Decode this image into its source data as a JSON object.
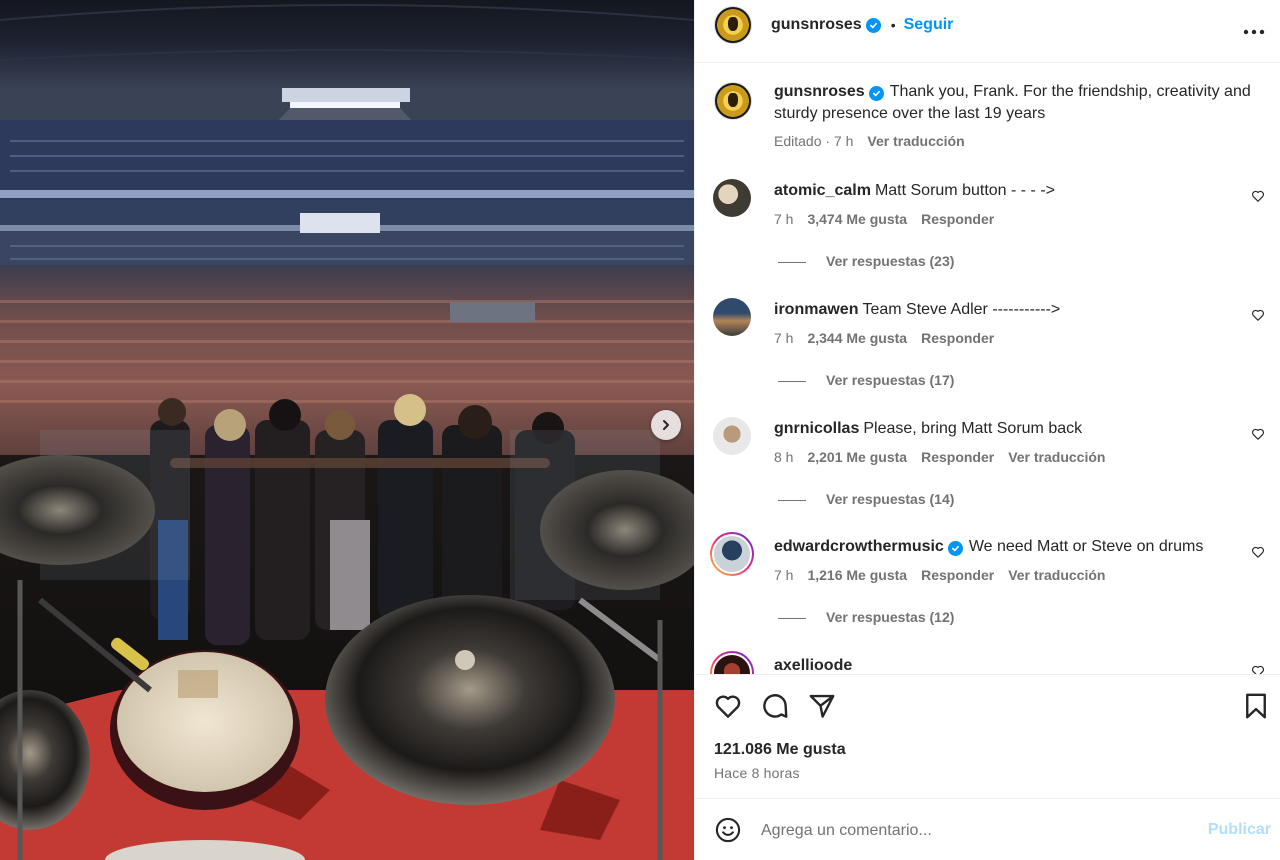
{
  "post": {
    "author": "gunsnroses",
    "follow_dot": "•",
    "follow_label": "Seguir",
    "more_icon": "more-horizontal-icon"
  },
  "caption": {
    "username": "gunsnroses",
    "text": "Thank you, Frank. For the friendship, creativity and sturdy presence over the last 19 years",
    "meta_edited": "Editado · 7 h",
    "translate_label": "Ver traducción"
  },
  "comments": [
    {
      "username": "atomic_calm",
      "text": "Matt Sorum button - - - ->",
      "time": "7 h",
      "likes": "3,474 Me gusta",
      "reply": "Responder",
      "translate": "",
      "replies": "Ver respuestas (23)",
      "verified": false
    },
    {
      "username": "ironmawen",
      "text": "Team Steve Adler ----------->",
      "time": "7 h",
      "likes": "2,344 Me gusta",
      "reply": "Responder",
      "translate": "",
      "replies": "Ver respuestas (17)",
      "verified": false
    },
    {
      "username": "gnrnicollas",
      "text": "Please, bring Matt Sorum back",
      "time": "8 h",
      "likes": "2,201 Me gusta",
      "reply": "Responder",
      "translate": "Ver traducción",
      "replies": "Ver respuestas (14)",
      "verified": false
    },
    {
      "username": "edwardcrowthermusic",
      "text": "We need Matt or Steve on drums",
      "time": "7 h",
      "likes": "1,216 Me gusta",
      "reply": "Responder",
      "translate": "Ver traducción",
      "replies": "Ver respuestas (12)",
      "verified": true
    },
    {
      "username": "axellioode",
      "text": "",
      "time": "",
      "likes": "",
      "reply": "",
      "translate": "",
      "replies": "",
      "verified": false
    }
  ],
  "actions": {
    "like_icon": "heart-icon",
    "comment_icon": "comment-icon",
    "share_icon": "send-icon",
    "save_icon": "bookmark-icon",
    "likes_count": "121.086 Me gusta",
    "timestamp": "Hace 8 horas"
  },
  "composer": {
    "emoji_icon": "emoji-icon",
    "placeholder": "Agrega un comentario...",
    "publish_label": "Publicar"
  },
  "colors": {
    "accent": "#0095f6",
    "text": "#262626",
    "muted": "#737373",
    "publish_disabled": "#b2dffc",
    "border": "#efefef"
  }
}
